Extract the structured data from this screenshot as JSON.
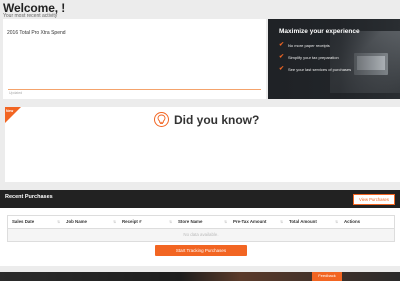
{
  "header": {
    "welcome": "Welcome, !",
    "subtitle": "Your most recent activity"
  },
  "spend": {
    "title": "2016 Total Pro Xtra Spend",
    "axis_label": "Updated"
  },
  "promo": {
    "title": "Maximize your experience",
    "items": [
      "No more paper receipts",
      "Simplify your tax preparation",
      "See your last services of purchases"
    ],
    "accent": "#f26522"
  },
  "did_you_know": {
    "ribbon": "New",
    "title": "Did you know?"
  },
  "recent_purchases": {
    "title": "Recent Purchases",
    "view_button": "View Purchases",
    "columns": [
      "Sales Date",
      "Job Name",
      "Receipt #",
      "Store Name",
      "Pre-Tax Amount",
      "Total Amount",
      "Actions"
    ],
    "empty_text": "No data available.",
    "start_button": "Start Tracking Purchases"
  },
  "footer": {
    "feedback": "Feedback"
  },
  "icons": {
    "check": "check-icon",
    "bulb": "lightbulb-icon",
    "sort": "sort-icon"
  }
}
